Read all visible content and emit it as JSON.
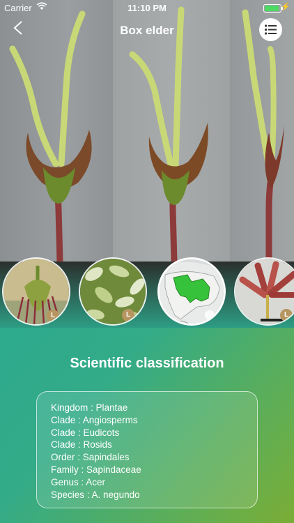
{
  "status_bar": {
    "carrier": "Carrier",
    "time": "11:10 PM"
  },
  "nav": {
    "title": "Box elder",
    "back_icon": "chevron-left-icon",
    "menu_icon": "list-icon"
  },
  "thumbnails": [
    {
      "name": "flower-cluster",
      "badge": "L"
    },
    {
      "name": "variegated-leaves",
      "badge": "L"
    },
    {
      "name": "distribution-map",
      "badge": ""
    },
    {
      "name": "red-samaras",
      "badge": "L"
    }
  ],
  "section": {
    "heading": "Scientific classification"
  },
  "classification": [
    {
      "rank": "Kingdom",
      "value": "Plantae",
      "text": "Kingdom : Plantae"
    },
    {
      "rank": "Clade",
      "value": "Angiosperms",
      "text": "Clade : Angiosperms"
    },
    {
      "rank": "Clade",
      "value": "Eudicots",
      "text": "Clade : Eudicots"
    },
    {
      "rank": "Clade",
      "value": "Rosids",
      "text": "Clade : Rosids"
    },
    {
      "rank": "Order",
      "value": "Sapindales",
      "text": "Order : Sapindales"
    },
    {
      "rank": "Family",
      "value": "Sapindaceae",
      "text": "Family : Sapindaceae"
    },
    {
      "rank": "Genus",
      "value": "Acer",
      "text": "Genus : Acer"
    },
    {
      "rank": "Species",
      "value": "A. negundo",
      "text": "Species : A. negundo"
    }
  ],
  "colors": {
    "accent_green": "#7bad35",
    "accent_teal": "#2ba98f",
    "battery": "#4cd964"
  }
}
